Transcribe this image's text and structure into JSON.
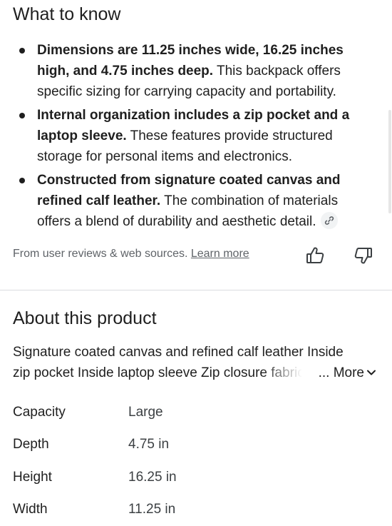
{
  "what_to_know": {
    "title": "What to know",
    "bullets": [
      {
        "bold": "Dimensions are 11.25 inches wide, 16.25 inches high, and 4.75 inches deep.",
        "text": " This backpack offers specific sizing for carrying capacity and portability."
      },
      {
        "bold": "Internal organization includes a zip pocket and a laptop sleeve.",
        "text": " These features provide structured storage for personal items and electronics."
      },
      {
        "bold": "Constructed from signature coated canvas and refined calf leather.",
        "text": " The combination of materials offers a blend of durability and aesthetic detail."
      }
    ],
    "sources_text": "From user reviews & web sources.",
    "learn_more": "Learn more"
  },
  "about": {
    "title": "About this product",
    "desc_line1": "Signature coated canvas and refined calf leather Inside",
    "desc_line2": "zip pocket Inside laptop sleeve Zip closure fabric lining",
    "more_label": "... More",
    "specs": [
      {
        "label": "Capacity",
        "value": "Large"
      },
      {
        "label": "Depth",
        "value": "4.75 in"
      },
      {
        "label": "Height",
        "value": "16.25 in"
      },
      {
        "label": "Width",
        "value": "11.25 in"
      }
    ]
  },
  "icons": {
    "link": "link-icon",
    "thumb_up": "thumbs-up-icon",
    "thumb_down": "thumbs-down-icon",
    "chevron": "chevron-down-icon"
  },
  "colors": {
    "text": "#1f1f1f",
    "secondary": "#5f6368",
    "divider": "#dadce0"
  }
}
